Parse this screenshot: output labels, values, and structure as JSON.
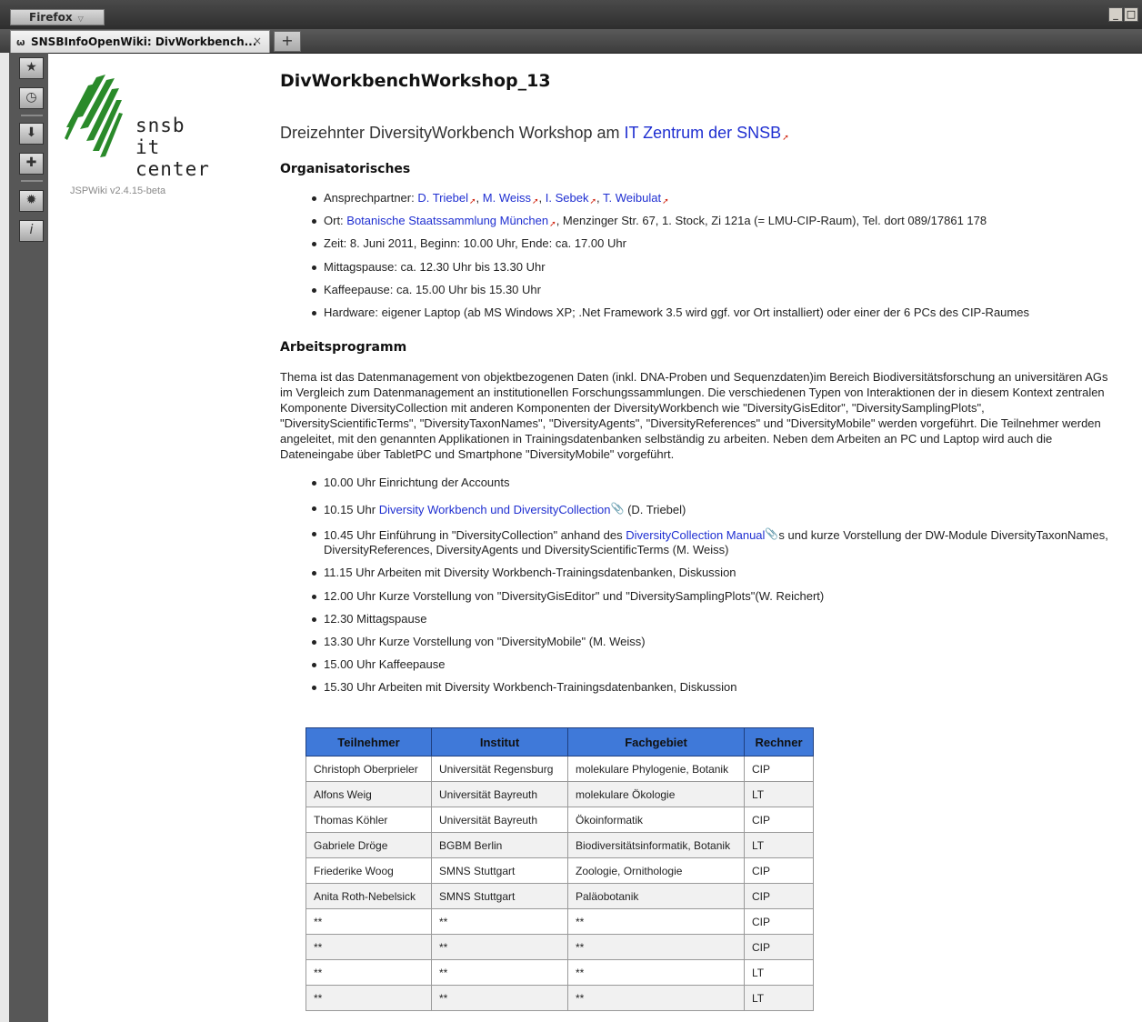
{
  "browser": {
    "menu_label": "Firefox",
    "tab_title": "SNSBInfoOpenWiki: DivWorkbench...",
    "tab_close": "×",
    "new_tab": "+",
    "window_buttons": [
      "_",
      "□"
    ]
  },
  "sidebar": {
    "buttons": [
      "bookmark-icon",
      "history-icon",
      "download-icon",
      "addon-icon",
      "settings-icon",
      "info-icon"
    ]
  },
  "wiki": {
    "logo_line1": "snsb",
    "logo_line2": "it center",
    "version": "JSPWiki v2.4.15-beta"
  },
  "page": {
    "title": "DivWorkbenchWorkshop_13",
    "subtitle_text": "Dreizehnter DiversityWorkbench Workshop am ",
    "subtitle_link": "IT Zentrum der SNSB",
    "org_heading": "Organisatorisches",
    "contact_prefix": "Ansprechpartner: ",
    "contacts": [
      "D. Triebel",
      "M. Weiss",
      "I. Sebek",
      "T. Weibulat"
    ],
    "location_prefix": "Ort: ",
    "location_link": "Botanische Staatssammlung München",
    "location_rest": ", Menzinger Str. 67, 1. Stock, Zi 121a (= LMU-CIP-Raum), Tel. dort 089/17861 178",
    "org_items": [
      "Zeit: 8. Juni 2011, Beginn: 10.00 Uhr, Ende: ca. 17.00 Uhr",
      "Mittagspause: ca. 12.30 Uhr bis 13.30 Uhr",
      "Kaffeepause: ca. 15.00 Uhr bis 15.30 Uhr",
      "Hardware: eigener Laptop (ab MS Windows XP; .Net Framework 3.5 wird ggf. vor Ort installiert) oder einer der 6 PCs des CIP-Raumes"
    ],
    "program_heading": "Arbeitsprogramm",
    "program_paragraph": "Thema ist das Datenmanagement von objektbezogenen Daten (inkl. DNA-Proben und Sequenzdaten)im Bereich Biodiversitätsforschung an universitären AGs im Vergleich zum Datenmanagement an institutionellen Forschungssammlungen. Die verschiedenen Typen von Interaktionen der in diesem Kontext zentralen Komponente DiversityCollection mit anderen Komponenten der DiversityWorkbench wie \"DiversityGisEditor\", \"DiversitySamplingPlots\", \"DiversityScientificTerms\", \"DiversityTaxonNames\", \"DiversityAgents\", \"DiversityReferences\" und \"DiversityMobile\" werden vorgeführt. Die Teilnehmer werden angeleitet, mit den genannten Applikationen in Trainingsdatenbanken selbständig zu arbeiten. Neben dem Arbeiten an PC und Laptop wird auch die Dateneingabe über TabletPC und Smartphone \"DiversityMobile\" vorgeführt.",
    "program_item1": "10.00 Uhr Einrichtung der Accounts",
    "program_item2_prefix": "10.15 Uhr ",
    "program_item2_link": "Diversity Workbench und DiversityCollection",
    "program_item2_suffix": " (D. Triebel)",
    "program_item3_prefix": "10.45 Uhr Einführung in \"DiversityCollection\" anhand des ",
    "program_item3_link": "DiversityCollection Manual",
    "program_item3_suffix": "s und kurze Vorstellung der DW-Module DiversityTaxonNames, DiversityReferences, DiversityAgents und DiversityScientificTerms (M. Weiss)",
    "program_items_rest": [
      "11.15 Uhr Arbeiten mit Diversity Workbench-Trainingsdatenbanken, Diskussion",
      "12.00 Uhr Kurze Vorstellung von \"DiversityGisEditor\" und \"DiversitySamplingPlots\"(W. Reichert)",
      "12.30 Mittagspause",
      "13.30 Uhr Kurze Vorstellung von \"DiversityMobile\" (M. Weiss)",
      "15.00 Uhr Kaffeepause",
      "15.30 Uhr Arbeiten mit Diversity Workbench-Trainingsdatenbanken, Diskussion"
    ]
  },
  "table": {
    "headers": [
      "Teilnehmer",
      "Institut",
      "Fachgebiet",
      "Rechner"
    ],
    "rows": [
      [
        "Christoph Oberprieler",
        "Universität Regensburg",
        "molekulare Phylogenie, Botanik",
        "CIP"
      ],
      [
        "Alfons Weig",
        "Universität Bayreuth",
        "molekulare Ökologie",
        "LT"
      ],
      [
        "Thomas Köhler",
        "Universität Bayreuth",
        "Ökoinformatik",
        "CIP"
      ],
      [
        "Gabriele Dröge",
        "BGBM Berlin",
        "Biodiversitätsinformatik, Botanik",
        "LT"
      ],
      [
        "Friederike Woog",
        "SMNS Stuttgart",
        "Zoologie, Ornithologie",
        "CIP"
      ],
      [
        "Anita Roth-Nebelsick",
        "SMNS Stuttgart",
        "Paläobotanik",
        "CIP"
      ],
      [
        "**",
        "**",
        "**",
        "CIP"
      ],
      [
        "**",
        "**",
        "**",
        "CIP"
      ],
      [
        "**",
        "**",
        "**",
        "LT"
      ],
      [
        "**",
        "**",
        "**",
        "LT"
      ]
    ]
  }
}
